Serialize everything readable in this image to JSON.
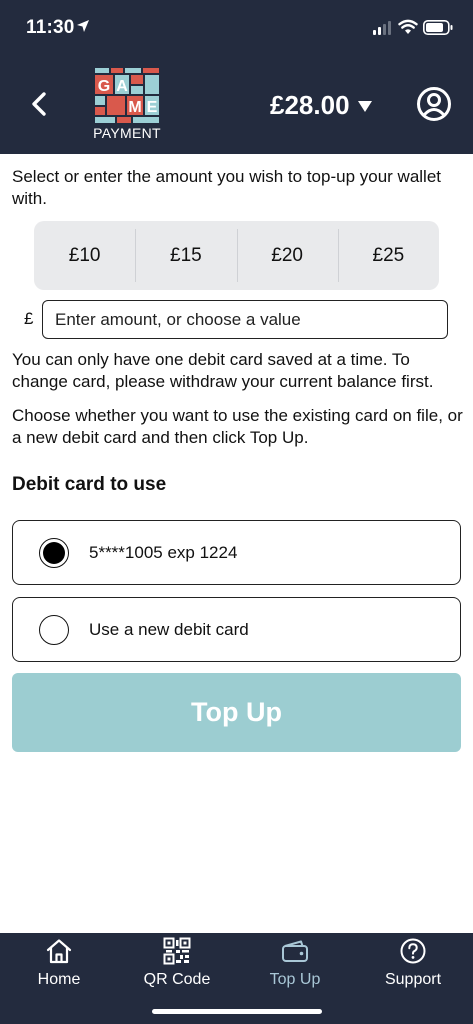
{
  "status_bar": {
    "time": "11:30"
  },
  "header": {
    "logo_letters": [
      "G",
      "A",
      "M",
      "E"
    ],
    "logo_subtitle": "PAYMENT",
    "balance": "£28.00",
    "back_icon": "chevron-left-icon",
    "profile_icon": "user-circle-icon"
  },
  "topup": {
    "intro": "Select or enter the amount you wish to top-up your wallet with.",
    "preset_amounts": [
      "£10",
      "£15",
      "£20",
      "£25"
    ],
    "currency_symbol": "£",
    "amount_placeholder": "Enter amount, or choose a value",
    "note_one_card": "You can only have one debit card saved at a time. To change card, please withdraw your current balance first.",
    "note_choose": "Choose whether you want to use the existing card on file, or a new debit card and then click Top Up.",
    "card_heading": "Debit card to use",
    "card_options": [
      {
        "label": "5****1005 exp 1224",
        "selected": true
      },
      {
        "label": "Use a new debit card",
        "selected": false
      }
    ],
    "submit_label": "Top Up"
  },
  "bottom_nav": {
    "items": [
      {
        "label": "Home",
        "icon": "home-icon",
        "active": false
      },
      {
        "label": "QR Code",
        "icon": "qr-code-icon",
        "active": false
      },
      {
        "label": "Top Up",
        "icon": "wallet-icon",
        "active": true
      },
      {
        "label": "Support",
        "icon": "help-circle-icon",
        "active": false
      }
    ]
  },
  "colors": {
    "header_bg": "#232b3e",
    "accent_button": "#9ccdd1",
    "nav_active": "#a9c7d6",
    "chip_bg": "#e9eaec",
    "logo_red": "#d9594c",
    "logo_teal": "#9ccfd5"
  }
}
